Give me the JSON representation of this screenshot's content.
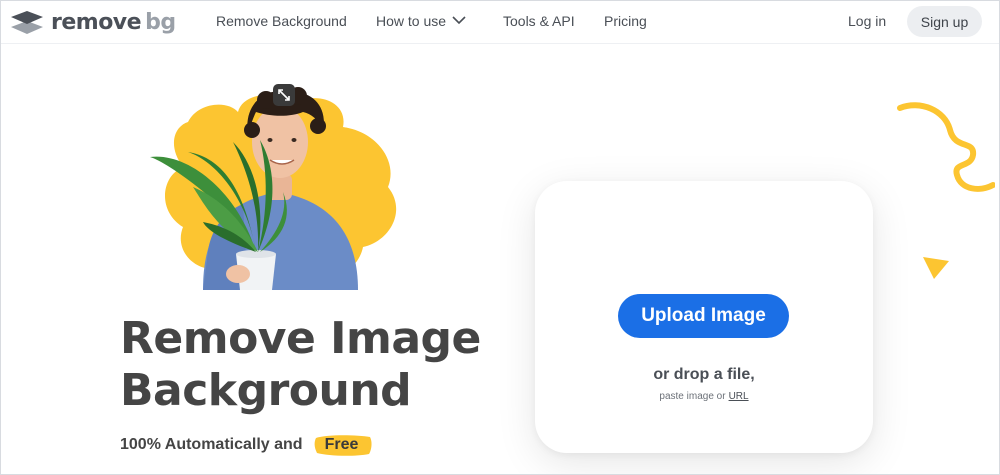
{
  "nav": {
    "brand_main": "remove",
    "brand_suffix": "bg",
    "links": [
      {
        "label": "Remove Background"
      },
      {
        "label": "How to use"
      },
      {
        "label": "Tools & API"
      },
      {
        "label": "Pricing"
      }
    ],
    "login_label": "Log in",
    "signup_label": "Sign up"
  },
  "hero": {
    "title_line1": "Remove Image",
    "title_line2": "Background",
    "subtitle": "100% Automatically and",
    "free_badge": "Free"
  },
  "upload": {
    "button_label": "Upload Image",
    "drop_text": "or drop a file,",
    "paste_text": "paste image or",
    "url_link": "URL"
  },
  "colors": {
    "accent": "#1b6fe6",
    "highlight": "#fcc531",
    "text": "#454545"
  },
  "icons": [
    "logo-icon",
    "chevron-down-icon",
    "expand-icon"
  ]
}
